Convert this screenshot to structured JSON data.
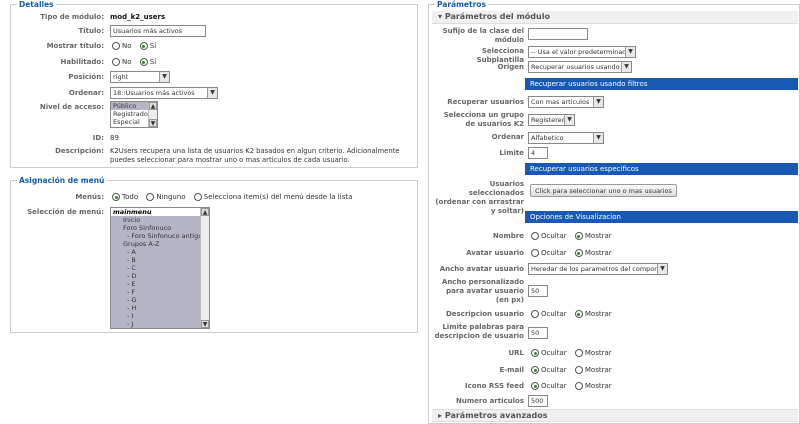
{
  "details": {
    "legend": "Detalles",
    "tipo_label": "Tipo de módulo:",
    "tipo_value": "mod_k2_users",
    "titulo_label": "Título:",
    "titulo_value": "Usuarios más activos",
    "mostrar_label": "Mostrar título:",
    "habilitado_label": "Habilitado:",
    "no_label": "No",
    "si_label": "Sí",
    "posicion_label": "Posición:",
    "posicion_value": "right",
    "ordenar_label": "Ordenar:",
    "ordenar_value": "18::Usuarios más activos",
    "acceso_label": "Nivel de acceso:",
    "acceso_options": [
      "Público",
      "Registrado",
      "Especial"
    ],
    "id_label": "ID:",
    "id_value": "89",
    "descripcion_label": "Descripción:",
    "descripcion_value": "K2Users recupera una lista de usuarios K2 basados en algun criterio. Adicionalmente puedes seleccionar para mostrar uno o mas articulos de cada usuario."
  },
  "menu": {
    "legend": "Asignación de menú",
    "menus_label": "Menús:",
    "opt_todo": "Todo",
    "opt_ninguno": "Ninguno",
    "opt_selecciona": "Selecciona item(s) del menú desde la lista",
    "seleccion_label": "Selección de menú:",
    "items": [
      "mainmenu",
      "Inicio",
      "Foro Sinfonuco",
      "- Foro Sinfonuco antiguo",
      "Grupos A-Z",
      "- A",
      "- B",
      "- C",
      "- D",
      "- E",
      "- F",
      "- G",
      "- H",
      "- I",
      "- J"
    ]
  },
  "params": {
    "legend": "Parámetros",
    "section_module": "Parámetros del módulo",
    "sufijo_label": "Sufijo de la clase del módulo",
    "subplantilla_label": "Selecciona Subplantilla",
    "subplantilla_value": "-- Usa el valor predeterminado --",
    "origen_label": "Origen",
    "origen_value": "Recuperar usuarios usando filtros",
    "band_filtros": "Recuperar usuarios usando filtros",
    "recuperar_label": "Recuperar usuarios",
    "recuperar_value": "Con mas articulos",
    "grupo_label": "Selecciona un grupo de usuarios K2",
    "grupo_value": "Registered",
    "ordenar_label": "Ordenar",
    "ordenar_value": "Alfabetico",
    "limite_label": "Limite",
    "limite_value": "4",
    "band_especificos": "Recuperar usuarios especificos",
    "seleccionados_label": "Usuarios seleccionados (ordenar con arrastrar y soltar)",
    "seleccionar_btn": "Click para seleccionar uno o mas usuarios",
    "band_opciones": "Opciones de Visualizacion",
    "nombre_label": "Nombre",
    "avatar_label": "Avatar usuario",
    "ocultar": "Ocultar",
    "mostrar": "Mostrar",
    "ancho_avatar_label": "Ancho avatar usuario",
    "ancho_avatar_value": "Heredar de los parametros del componente",
    "ancho_pers_label": "Ancho personalizado para avatar usuario (en px)",
    "ancho_pers_value": "50",
    "descripcion_label": "Descripcion usuario",
    "limite_palabras_label": "Limite palabras para descripcion de usuario",
    "limite_palabras_value": "50",
    "url_label": "URL",
    "email_label": "E-mail",
    "rss_label": "Icono RSS feed",
    "numero_label": "Numero articulos",
    "numero_value": "500",
    "section_advanced": "Parámetros avanzados"
  }
}
